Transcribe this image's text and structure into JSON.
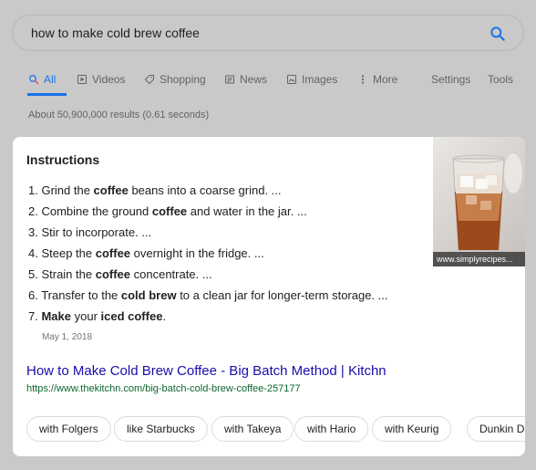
{
  "search": {
    "query": "how to make cold brew coffee",
    "icon": "search-icon"
  },
  "tabs": [
    {
      "label": "All",
      "icon": "search-icon",
      "active": true
    },
    {
      "label": "Videos",
      "icon": "play-icon"
    },
    {
      "label": "Shopping",
      "icon": "tag-icon"
    },
    {
      "label": "News",
      "icon": "news-icon"
    },
    {
      "label": "Images",
      "icon": "image-icon"
    },
    {
      "label": "More",
      "icon": "more-vert-icon"
    },
    {
      "label": "Settings"
    },
    {
      "label": "Tools"
    }
  ],
  "stats": "About 50,900,000 results (0.61 seconds)",
  "snippet": {
    "heading": "Instructions",
    "steps": [
      [
        {
          "t": "1. Grind the "
        },
        {
          "t": "coffee",
          "b": true
        },
        {
          "t": " beans into a coarse grind. ..."
        }
      ],
      [
        {
          "t": "2. Combine the ground "
        },
        {
          "t": "coffee",
          "b": true
        },
        {
          "t": " and water in the jar. ..."
        }
      ],
      [
        {
          "t": "3. Stir to incorporate. ..."
        }
      ],
      [
        {
          "t": "4. Steep the "
        },
        {
          "t": "coffee",
          "b": true
        },
        {
          "t": " overnight in the fridge. ..."
        }
      ],
      [
        {
          "t": "5. Strain the "
        },
        {
          "t": "coffee",
          "b": true
        },
        {
          "t": " concentrate. ..."
        }
      ],
      [
        {
          "t": "6. Transfer to the "
        },
        {
          "t": "cold brew",
          "b": true
        },
        {
          "t": " to a clean jar for longer-term storage. ..."
        }
      ],
      [
        {
          "t": "7. "
        },
        {
          "t": "Make",
          "b": true
        },
        {
          "t": " your "
        },
        {
          "t": "iced coffee",
          "b": true
        },
        {
          "t": "."
        }
      ]
    ],
    "date": "May 1, 2018",
    "image_caption": "www.simplyrecipes...",
    "result_title": "How to Make Cold Brew Coffee - Big Batch Method | Kitchn",
    "result_url": "https://www.thekitchn.com/big-batch-cold-brew-coffee-257177"
  },
  "chips": [
    "with Folgers",
    "like Starbucks",
    "with Takeya",
    "with Hario",
    "with Keurig",
    "Dunkin Donuts"
  ],
  "colors": {
    "accent": "#1a73e8",
    "link": "#1a0dab",
    "url": "#0d652d",
    "background": "#c9c9c9"
  }
}
